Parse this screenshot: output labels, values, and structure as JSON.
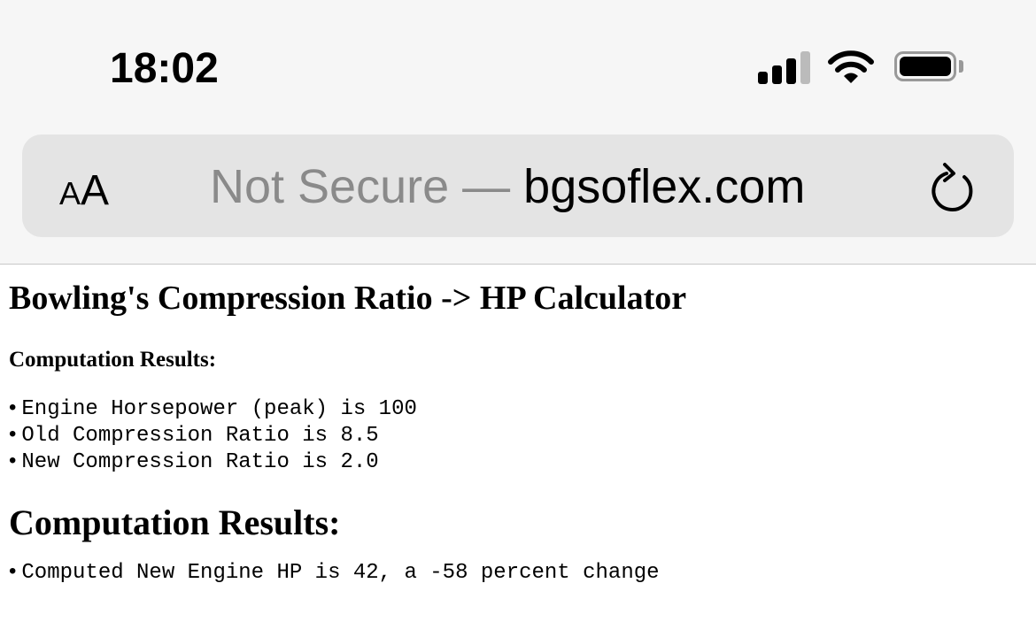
{
  "status": {
    "time": "18:02"
  },
  "browser": {
    "aa_small": "A",
    "aa_large": "A",
    "not_secure": "Not Secure —",
    "domain": "bgsoflex.com"
  },
  "page": {
    "title": "Bowling's Compression Ratio -> HP Calculator",
    "section1": "Computation Results:",
    "inputs": [
      "Engine Horsepower (peak) is 100",
      "Old Compression Ratio is 8.5",
      "New Compression Ratio is 2.0"
    ],
    "section2": "Computation Results:",
    "results": [
      "Computed New Engine HP is 42, a -58 percent change"
    ]
  }
}
